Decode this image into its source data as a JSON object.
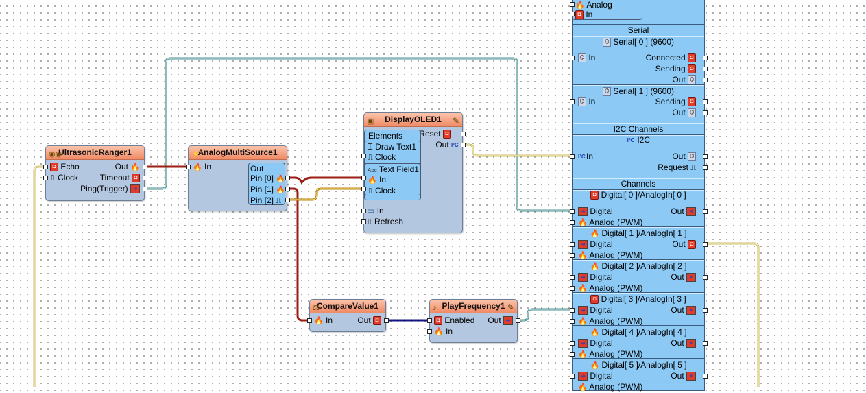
{
  "colors": {
    "wire_red": "#9b1d14",
    "wire_teal": "#5f9ea0",
    "wire_yellow": "#d2c774",
    "wire_blue": "#1a1a9a",
    "wire_amber": "#c8961e",
    "header_orange": "#f08a66",
    "component_body": "#b4c7e0",
    "board_blue": "#8ccaf5"
  },
  "ultrasonic": {
    "title": "UltrasonicRanger1",
    "echo": "Echo",
    "clock": "Clock",
    "out": "Out",
    "timeout": "Timeout",
    "ping": "Ping(Trigger)"
  },
  "analog_multi": {
    "title": "AnalogMultiSource1",
    "in": "In",
    "out_group": "Out",
    "pin0": "Pin [0]",
    "pin1": "Pin [1]",
    "pin2": "Pin [2]"
  },
  "display": {
    "title": "DisplayOLED1",
    "reset": "Reset",
    "out": "Out",
    "elements": "Elements",
    "draw_text": "Draw Text1",
    "draw_clock": "Clock",
    "text_field": "Text Field1",
    "tf_in": "In",
    "tf_clock": "Clock",
    "in": "In",
    "refresh": "Refresh"
  },
  "compare": {
    "title": "CompareValue1",
    "in": "In",
    "out": "Out"
  },
  "play": {
    "title": "PlayFrequency1",
    "enabled": "Enabled",
    "in": "In",
    "out": "Out"
  },
  "board": {
    "top_analog": "Analog",
    "top_in": "In",
    "serial_title": "Serial",
    "serial0": "Serial[ 0 ] (9600)",
    "serial0_in": "In",
    "serial0_connected": "Connected",
    "serial0_sending": "Sending",
    "serial0_out": "Out",
    "serial1": "Serial[ 1 ] (9600)",
    "serial1_in": "In",
    "serial1_sending": "Sending",
    "serial1_out": "Out",
    "i2c_title": "I2C Channels",
    "i2c_sub": "I2C",
    "i2c_in": "In",
    "i2c_out": "Out",
    "i2c_request": "Request",
    "channels_title": "Channels",
    "channels": [
      {
        "name": "Digital[ 0 ]/AnalogIn[ 0 ]",
        "digital": "Digital",
        "analog": "Analog (PWM)",
        "out": "Out"
      },
      {
        "name": "Digital[ 1 ]/AnalogIn[ 1 ]",
        "digital": "Digital",
        "analog": "Analog (PWM)",
        "out": "Out"
      },
      {
        "name": "Digital[ 2 ]/AnalogIn[ 2 ]",
        "digital": "Digital",
        "analog": "Analog (PWM)",
        "out": "Out"
      },
      {
        "name": "Digital[ 3 ]/AnalogIn[ 3 ]",
        "digital": "Digital",
        "analog": "Analog (PWM)",
        "out": "Out"
      },
      {
        "name": "Digital[ 4 ]/AnalogIn[ 4 ]",
        "digital": "Digital",
        "analog": "Analog (PWM)",
        "out": "Out"
      },
      {
        "name": "Digital[ 5 ]/AnalogIn[ 5 ]",
        "digital": "Digital",
        "analog": "Analog (PWM)",
        "out": "Out"
      }
    ]
  }
}
